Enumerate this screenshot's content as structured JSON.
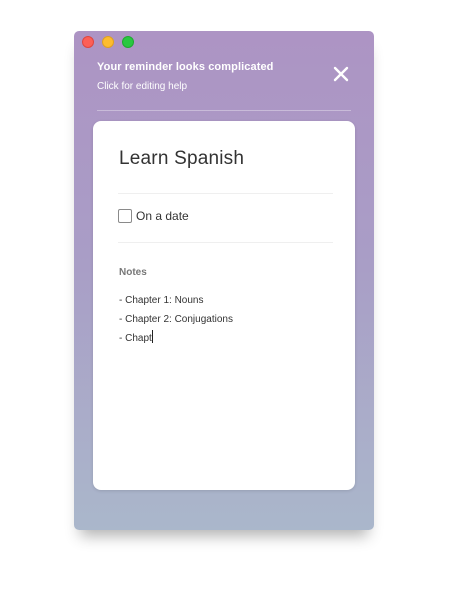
{
  "window": {
    "controls": [
      "close",
      "minimize",
      "maximize"
    ]
  },
  "banner": {
    "title": "Your reminder looks complicated",
    "subtitle": "Click for editing help",
    "dismiss_icon": "close-x-icon"
  },
  "reminder": {
    "title": "Learn Spanish",
    "date_option": {
      "label": "On a date",
      "checked": false
    },
    "notes_label": "Notes",
    "notes_lines": [
      "- Chapter 1: Nouns",
      "- Chapter 2: Conjugations",
      "- Chapt"
    ]
  },
  "colors": {
    "gradient_top": "#ad94c4",
    "gradient_bottom": "#aab7cb",
    "card": "#ffffff",
    "close": "#fc5f57",
    "minimize": "#fdbc2e",
    "maximize": "#28c840"
  }
}
